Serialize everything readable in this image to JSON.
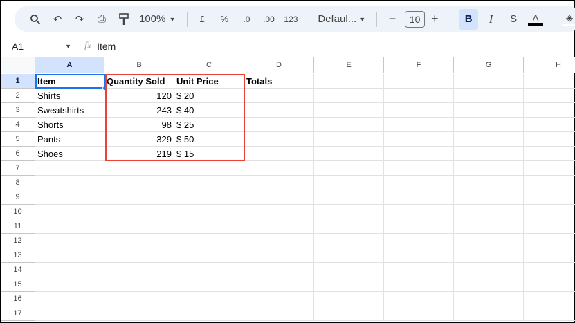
{
  "toolbar": {
    "zoom": "100%",
    "currency": "£",
    "percent": "%",
    "dec_less": ".0",
    "dec_more": ".00",
    "number_format": "123",
    "font": "Defaul...",
    "font_size": "10",
    "bold": "B",
    "italic": "I",
    "text_color_letter": "A"
  },
  "formula_bar": {
    "cell_ref": "A1",
    "fx": "fx",
    "value": "Item"
  },
  "columns": [
    "A",
    "B",
    "C",
    "D",
    "E",
    "F",
    "G",
    "H"
  ],
  "rows": [
    "1",
    "2",
    "3",
    "4",
    "5",
    "6",
    "7",
    "8",
    "9",
    "10",
    "11",
    "12",
    "13",
    "14",
    "15",
    "16",
    "17"
  ],
  "cells": [
    [
      "Item",
      "Quantity Sold",
      "Unit Price",
      "Totals"
    ],
    [
      "Shirts",
      "120",
      "$ 20"
    ],
    [
      "Sweatshirts",
      "243",
      "$ 40"
    ],
    [
      "Shorts",
      "98",
      "$ 25"
    ],
    [
      "Pants",
      "329",
      "$ 50"
    ],
    [
      "Shoes",
      "219",
      "$ 15"
    ]
  ],
  "colors": {
    "selection": "#1a73e8",
    "highlight": "#ea4335"
  }
}
